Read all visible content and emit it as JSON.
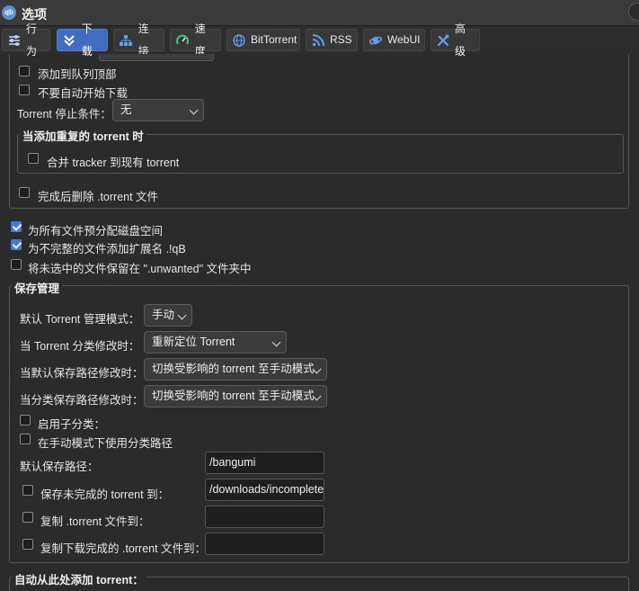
{
  "window": {
    "title": "选项",
    "app_icon_text": "qb"
  },
  "tabs": [
    {
      "label": "行为",
      "icon": "sliders-icon"
    },
    {
      "label": "下载",
      "icon": "download-icon"
    },
    {
      "label": "连接",
      "icon": "network-icon"
    },
    {
      "label": "速度",
      "icon": "speedometer-icon"
    },
    {
      "label": "BitTorrent",
      "icon": "globe-icon"
    },
    {
      "label": "RSS",
      "icon": "rss-icon"
    },
    {
      "label": "WebUI",
      "icon": "web-icon"
    },
    {
      "label": "高级",
      "icon": "tools-icon"
    }
  ],
  "top_section": {
    "add_to_queue_top": {
      "label": "添加到队列顶部",
      "checked": false
    },
    "dont_start": {
      "label": "不要自动开始下载",
      "checked": false
    },
    "stop_condition": {
      "label": "Torrent 停止条件：",
      "value": "无"
    },
    "duplicate_group": {
      "title": "当添加重复的 torrent 时",
      "merge_trackers": {
        "label": "合并 tracker 到现有 torrent",
        "checked": false
      }
    },
    "delete_after": {
      "label": "完成后删除 .torrent 文件",
      "checked": false
    }
  },
  "preallocate": {
    "label": "为所有文件预分配磁盘空间",
    "checked": true
  },
  "append_ext": {
    "label": "为不完整的文件添加扩展名 .!qB",
    "checked": true
  },
  "keep_unwanted": {
    "label": "将未选中的文件保留在 \".unwanted\" 文件夹中",
    "checked": false
  },
  "save_management": {
    "title": "保存管理",
    "rows": [
      {
        "label": "默认 Torrent 管理模式：",
        "value": "手动"
      },
      {
        "label": "当 Torrent 分类修改时：",
        "value": "重新定位 Torrent"
      },
      {
        "label": "当默认保存路径修改时：",
        "value": "切换受影响的 torrent 至手动模式"
      },
      {
        "label": "当分类保存路径修改时：",
        "value": "切换受影响的 torrent 至手动模式"
      }
    ],
    "subcategories": {
      "label": "启用子分类：",
      "checked": false
    },
    "category_paths_manual": {
      "label": "在手动模式下使用分类路径",
      "checked": false
    },
    "default_save_path": {
      "label": "默认保存路径：",
      "value": "/bangumi"
    },
    "incomplete_path": {
      "label": "保存未完成的 torrent 到：",
      "value": "/downloads/incomplete",
      "checked": false
    },
    "copy_torrent": {
      "label": "复制 .torrent 文件到：",
      "value": "",
      "checked": false
    },
    "copy_finished": {
      "label": "复制下载完成的 .torrent 文件到：",
      "value": "",
      "checked": false
    }
  },
  "auto_add": {
    "title": "自动从此处添加 torrent："
  }
}
